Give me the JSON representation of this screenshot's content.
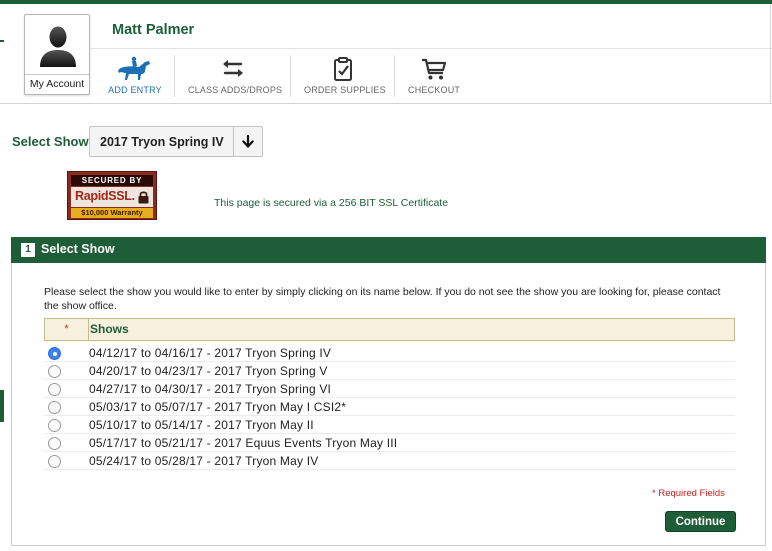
{
  "header": {
    "user_name": "Matt Palmer",
    "account_label": "My Account",
    "nav": [
      {
        "label": "ADD ENTRY",
        "icon": "horse-rider-icon",
        "active": true
      },
      {
        "label": "CLASS ADDS/DROPS",
        "icon": "swap-arrows-icon"
      },
      {
        "label": "ORDER SUPPLIES",
        "icon": "clipboard-check-icon"
      },
      {
        "label": "CHECKOUT",
        "icon": "shopping-cart-icon"
      }
    ]
  },
  "select_show": {
    "label": "Select Show",
    "value": "2017 Tryon Spring IV"
  },
  "ssl": {
    "badge_top": "SECURED BY",
    "badge_name": "RapidSSL.",
    "badge_warranty": "$10,000 Warranty",
    "message": "This page is secured via a 256 BIT SSL Certificate"
  },
  "panel": {
    "step": "1",
    "title": "Select Show",
    "intro": "Please select the show you would like to enter by simply clicking on its name below. If you do not see the show you are looking for, please contact the show office.",
    "table": {
      "required_marker": "*",
      "column_header": "Shows",
      "rows": [
        {
          "text": "04/12/17 to 04/16/17 - 2017 Tryon Spring IV",
          "selected": true
        },
        {
          "text": "04/20/17 to 04/23/17 - 2017 Tryon Spring V",
          "selected": false
        },
        {
          "text": "04/27/17 to 04/30/17 - 2017 Tryon Spring VI",
          "selected": false
        },
        {
          "text": "05/03/17 to 05/07/17 - 2017 Tryon May I CSI2*",
          "selected": false
        },
        {
          "text": "05/10/17 to 05/14/17 - 2017 Tryon May II",
          "selected": false
        },
        {
          "text": "05/17/17 to 05/21/17 - 2017 Equus Events Tryon May III",
          "selected": false
        },
        {
          "text": "05/24/17 to 05/28/17 - 2017 Tryon May IV",
          "selected": false
        }
      ]
    },
    "required_note": "* Required Fields",
    "continue_label": "Continue"
  },
  "colors": {
    "brand_green": "#1d5e38",
    "active_nav_blue": "#1a6fb5",
    "required_red": "#c81e1e",
    "table_header_bg": "#f7f0dc"
  }
}
